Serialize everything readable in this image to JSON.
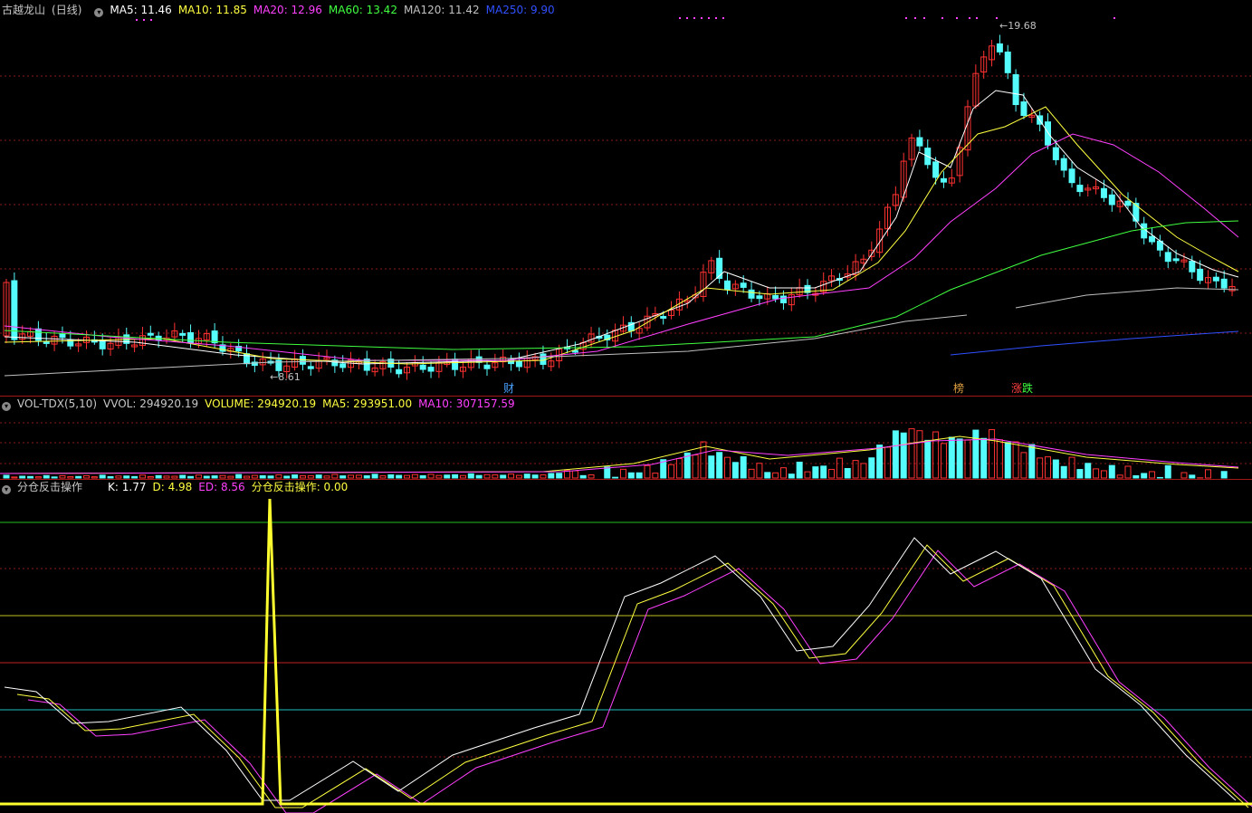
{
  "price": {
    "stock_name": "古越龙山",
    "period": "(日线)",
    "ma": [
      {
        "label": "MA5: 11.46",
        "color": "#ffffff"
      },
      {
        "label": "MA10: 11.85",
        "color": "#ffff40"
      },
      {
        "label": "MA20: 12.96",
        "color": "#ff40ff"
      },
      {
        "label": "MA60: 13.42",
        "color": "#40ff40"
      },
      {
        "label": "MA120: 11.42",
        "color": "#c0c0c0"
      },
      {
        "label": "MA250: 9.90",
        "color": "#3050ff"
      }
    ],
    "high_label": "19.68",
    "low_label": "8.61",
    "markers": [
      {
        "text": "财",
        "color": "#4aa0ff"
      },
      {
        "text": "榜",
        "color": "#e0a040"
      },
      {
        "text": "涨",
        "color": "#ff4040"
      },
      {
        "text": "跌",
        "color": "#40ff40"
      }
    ]
  },
  "volume": {
    "name": "VOL-TDX(5,10)",
    "vvol": "VVOL: 294920.19",
    "volume": "VOLUME: 294920.19",
    "ma5": "MA5: 293951.00",
    "ma10": "MA10: 307157.59"
  },
  "indicator": {
    "name": "分仓反击操作",
    "k": "K: 1.77",
    "d": "D: 4.98",
    "ed": "ED: 8.56",
    "signal": "分仓反击操作: 0.00"
  },
  "colors": {
    "up": "#ff3232",
    "down": "#54fcfc",
    "grid": "#8b1a1a"
  }
}
